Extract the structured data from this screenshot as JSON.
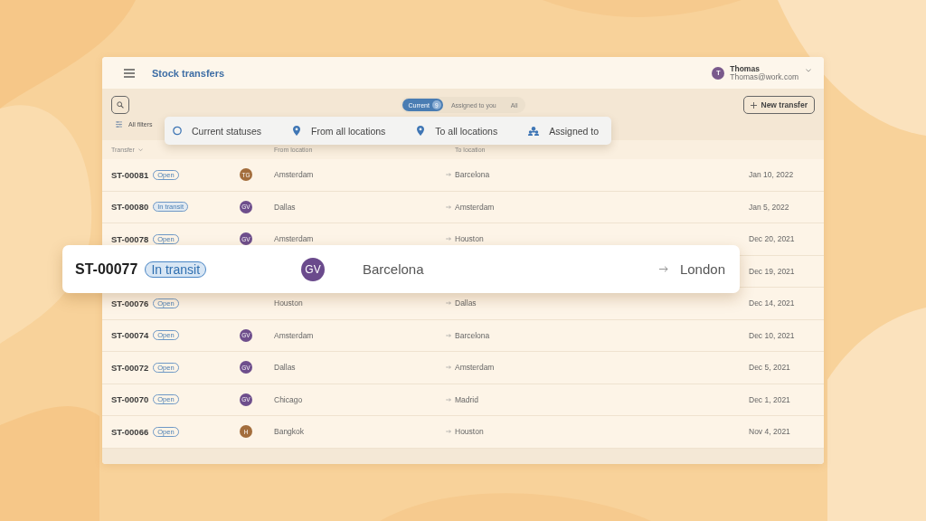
{
  "header": {
    "title": "Stock transfers",
    "user": {
      "initials": "T",
      "color": "#7a5a8c",
      "name": "Thomas",
      "email": "Thomas@work.com"
    }
  },
  "toolbar": {
    "tabs": [
      {
        "label": "Current",
        "count": "9",
        "selected": true
      },
      {
        "label": "Assigned to you",
        "selected": false
      },
      {
        "label": "All",
        "selected": false
      }
    ],
    "new_button": "New transfer",
    "all_filters": "All filters"
  },
  "filter_bar": [
    {
      "kind": "status",
      "label": "Current statuses"
    },
    {
      "kind": "location",
      "label": "From all locations"
    },
    {
      "kind": "location",
      "label": "To all locations"
    },
    {
      "kind": "person",
      "label": "Assigned to"
    }
  ],
  "table": {
    "columns": [
      {
        "label": "Transfer",
        "sortable": true
      },
      {
        "label": "From location",
        "sortable": false
      },
      {
        "label": "To location",
        "sortable": false
      }
    ],
    "rows": [
      {
        "id": "ST-00081",
        "status": {
          "label": "Open",
          "kind": "open"
        },
        "assignee": {
          "initials": "TG",
          "color": "#a36d3c"
        },
        "from": "Amsterdam",
        "to": "Barcelona",
        "date": "Jan 10, 2022"
      },
      {
        "id": "ST-00080",
        "status": {
          "label": "In transit",
          "kind": "in_transit"
        },
        "assignee": {
          "initials": "GV",
          "color": "#6e4e8c"
        },
        "from": "Dallas",
        "to": "Amsterdam",
        "date": "Jan 5, 2022"
      },
      {
        "id": "ST-00078",
        "status": {
          "label": "Open",
          "kind": "open"
        },
        "assignee": {
          "initials": "GV",
          "color": "#6e4e8c"
        },
        "from": "Amsterdam",
        "to": "Houston",
        "date": "Dec 20, 2021"
      },
      {
        "date": "Dec 19, 2021"
      },
      {
        "id": "ST-00076",
        "status": {
          "label": "Open",
          "kind": "open"
        },
        "from": "Houston",
        "to": "Dallas",
        "date": "Dec 14, 2021"
      },
      {
        "id": "ST-00074",
        "status": {
          "label": "Open",
          "kind": "open"
        },
        "assignee": {
          "initials": "GV",
          "color": "#6e4e8c"
        },
        "from": "Amsterdam",
        "to": "Barcelona",
        "date": "Dec 10, 2021"
      },
      {
        "id": "ST-00072",
        "status": {
          "label": "Open",
          "kind": "open"
        },
        "assignee": {
          "initials": "GV",
          "color": "#6e4e8c"
        },
        "from": "Dallas",
        "to": "Amsterdam",
        "date": "Dec 5, 2021"
      },
      {
        "id": "ST-00070",
        "status": {
          "label": "Open",
          "kind": "open"
        },
        "assignee": {
          "initials": "GV",
          "color": "#6e4e8c"
        },
        "from": "Chicago",
        "to": "Madrid",
        "date": "Dec 1, 2021"
      },
      {
        "id": "ST-00066",
        "status": {
          "label": "Open",
          "kind": "open"
        },
        "assignee": {
          "initials": "H",
          "color": "#a36d3c"
        },
        "from": "Bangkok",
        "to": "Houston",
        "date": "Nov 4, 2021"
      }
    ]
  },
  "zoomed_row": {
    "id": "ST-00077",
    "status": {
      "label": "In transit",
      "kind": "in_transit"
    },
    "assignee": {
      "initials": "GV",
      "color": "#6a4a8c"
    },
    "from": "Barcelona",
    "to": "London"
  }
}
